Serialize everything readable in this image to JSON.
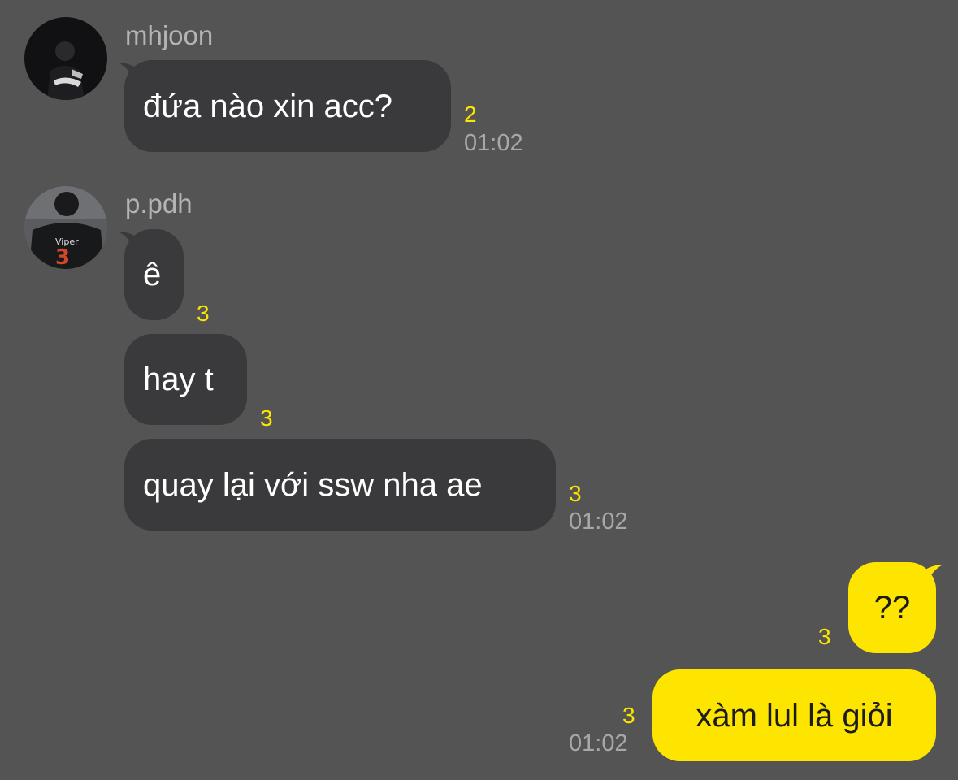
{
  "colors": {
    "background": "#545454",
    "incoming_bubble": "#3a3a3c",
    "outgoing_bubble": "#fee500",
    "unread_count": "#fee500",
    "timestamp": "#a8a8a8",
    "sender_name": "#b4b4b4"
  },
  "messages": {
    "group1": {
      "sender": "mhjoon",
      "avatar": "avatar-photo-dark-figure",
      "m1": {
        "text": "đứa nào xin acc?",
        "unread": "2",
        "time": "01:02"
      }
    },
    "group2": {
      "sender": "p.pdh",
      "avatar": "avatar-photo-viper-jersey",
      "avatar_jersey_name": "Viper",
      "avatar_jersey_number": "3",
      "m1": {
        "text": "ê",
        "unread": "3"
      },
      "m2": {
        "text": "hay t",
        "unread": "3"
      },
      "m3": {
        "text": "quay lại với ssw nha ae",
        "unread": "3",
        "time": "01:02"
      }
    },
    "group3": {
      "sender": "me",
      "m1": {
        "text": "??",
        "unread": "3"
      },
      "m2": {
        "text": "xàm lul là giỏi",
        "unread": "3",
        "time": "01:02"
      }
    }
  }
}
